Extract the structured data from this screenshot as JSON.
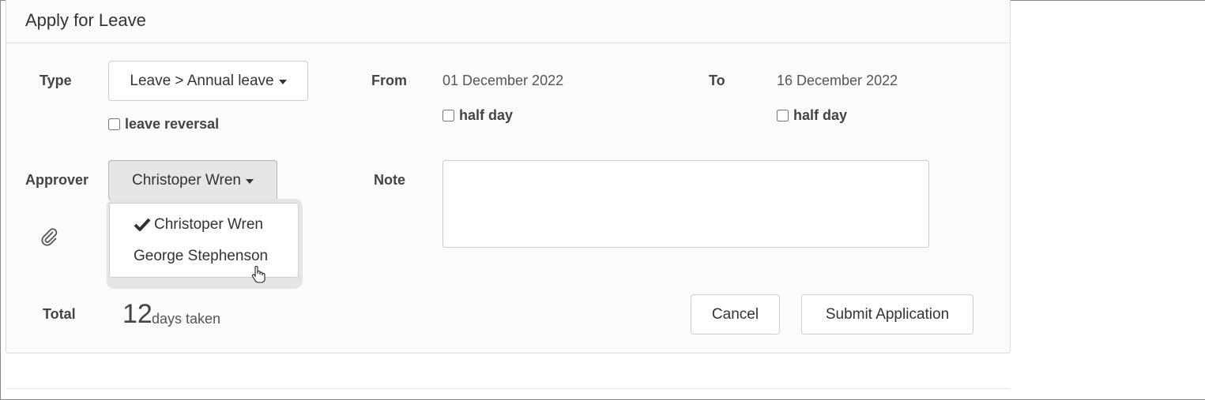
{
  "form": {
    "title": "Apply for Leave",
    "type": {
      "label": "Type",
      "selected": "Leave > Annual leave"
    },
    "leave_reversal": {
      "label": "leave reversal",
      "checked": false
    },
    "from": {
      "label": "From",
      "date": "01 December 2022",
      "half_day_label": "half day",
      "half_day_checked": false
    },
    "to": {
      "label": "To",
      "date": "16 December 2022",
      "half_day_label": "half day",
      "half_day_checked": false
    },
    "approver": {
      "label": "Approver",
      "selected": "Christoper Wren",
      "options": [
        "Christoper Wren",
        "George Stephenson"
      ]
    },
    "note": {
      "label": "Note",
      "value": ""
    },
    "attachment_icon": "paperclip-icon",
    "total": {
      "label": "Total",
      "value": "12",
      "unit": "days taken"
    },
    "buttons": {
      "cancel": "Cancel",
      "submit": "Submit Application"
    }
  },
  "icons": {
    "selected_option": "checkmark-icon",
    "dropdown": "caret-down-icon",
    "cursor": "hand-pointer-icon"
  },
  "colors": {
    "panel_bg": "#fbfbfb",
    "border": "#cfcfcf",
    "text": "#333333"
  }
}
